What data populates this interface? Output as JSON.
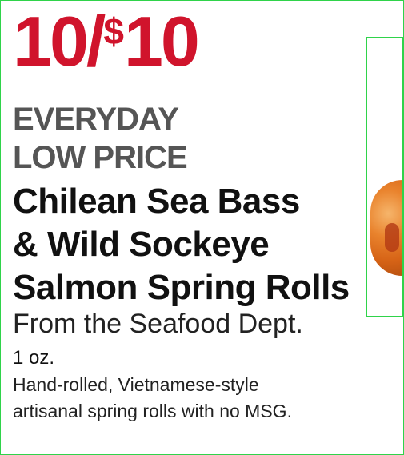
{
  "ad": {
    "price": {
      "quantity": "10/",
      "currency": "$",
      "amount": "10"
    },
    "edlp_line1": "EVERYDAY",
    "edlp_line2": "LOW PRICE",
    "title_line1": "Chilean Sea Bass",
    "title_line2": "& Wild Sockeye",
    "title_line3": "Salmon Spring Rolls",
    "department": "From the Seafood Dept.",
    "size": "1 oz.",
    "description_line1": "Hand-rolled, Vietnamese-style",
    "description_line2": "artisanal spring rolls with no MSG.",
    "colors": {
      "price": "#d0142c",
      "edlp": "#555555",
      "frame": "#2fd34a"
    },
    "product_image": "spring-roll-photo"
  }
}
